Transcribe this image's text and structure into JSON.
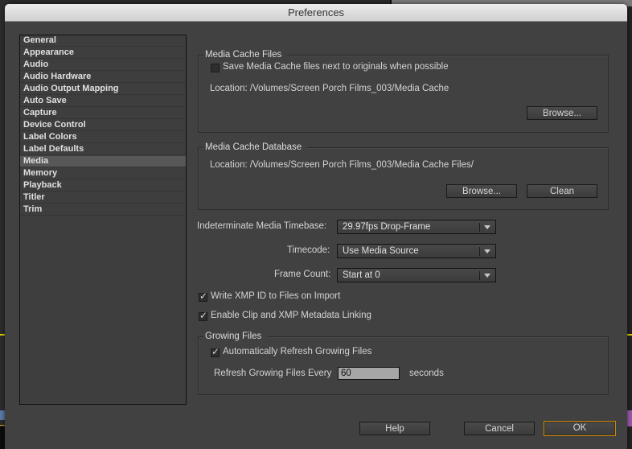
{
  "window": {
    "title": "Preferences"
  },
  "sidebar": {
    "items": [
      {
        "label": "General"
      },
      {
        "label": "Appearance"
      },
      {
        "label": "Audio"
      },
      {
        "label": "Audio Hardware"
      },
      {
        "label": "Audio Output Mapping"
      },
      {
        "label": "Auto Save"
      },
      {
        "label": "Capture"
      },
      {
        "label": "Device Control"
      },
      {
        "label": "Label Colors"
      },
      {
        "label": "Label Defaults"
      },
      {
        "label": "Media",
        "selected": true
      },
      {
        "label": "Memory"
      },
      {
        "label": "Playback"
      },
      {
        "label": "Titler"
      },
      {
        "label": "Trim"
      }
    ],
    "selected": "Media"
  },
  "media_cache_files": {
    "legend": "Media Cache Files",
    "save_next_to_originals": {
      "label": "Save Media Cache files next to originals when possible",
      "checked": false
    },
    "location": "Location:  /Volumes/Screen Porch Films_003/Media Cache",
    "browse_label": "Browse..."
  },
  "media_cache_database": {
    "legend": "Media Cache Database",
    "location": "Location:  /Volumes/Screen Porch Films_003/Media Cache Files/",
    "browse_label": "Browse...",
    "clean_label": "Clean"
  },
  "settings": {
    "timebase": {
      "label": "Indeterminate Media Timebase:",
      "value": "29.97fps Drop-Frame"
    },
    "timecode": {
      "label": "Timecode:",
      "value": "Use Media Source"
    },
    "frame_count": {
      "label": "Frame Count:",
      "value": "Start at 0"
    },
    "write_xmp": {
      "label": "Write XMP ID to Files on Import",
      "checked": true
    },
    "enable_clip_xmp": {
      "label": "Enable Clip and XMP Metadata Linking",
      "checked": true
    }
  },
  "growing_files": {
    "legend": "Growing Files",
    "auto_refresh": {
      "label": "Automatically Refresh Growing Files",
      "checked": true
    },
    "refresh_label": "Refresh Growing Files Every",
    "refresh_value": "60",
    "refresh_unit": "seconds"
  },
  "footer": {
    "help_label": "Help",
    "cancel_label": "Cancel",
    "ok_label": "OK"
  },
  "colors": {
    "accent_ok_border": "#c88a10",
    "dialog_bg": "#414141",
    "selected_item_bg": "#575757"
  },
  "icons": {
    "checkmark": "✓",
    "dropdown": "chevron-down-icon"
  }
}
